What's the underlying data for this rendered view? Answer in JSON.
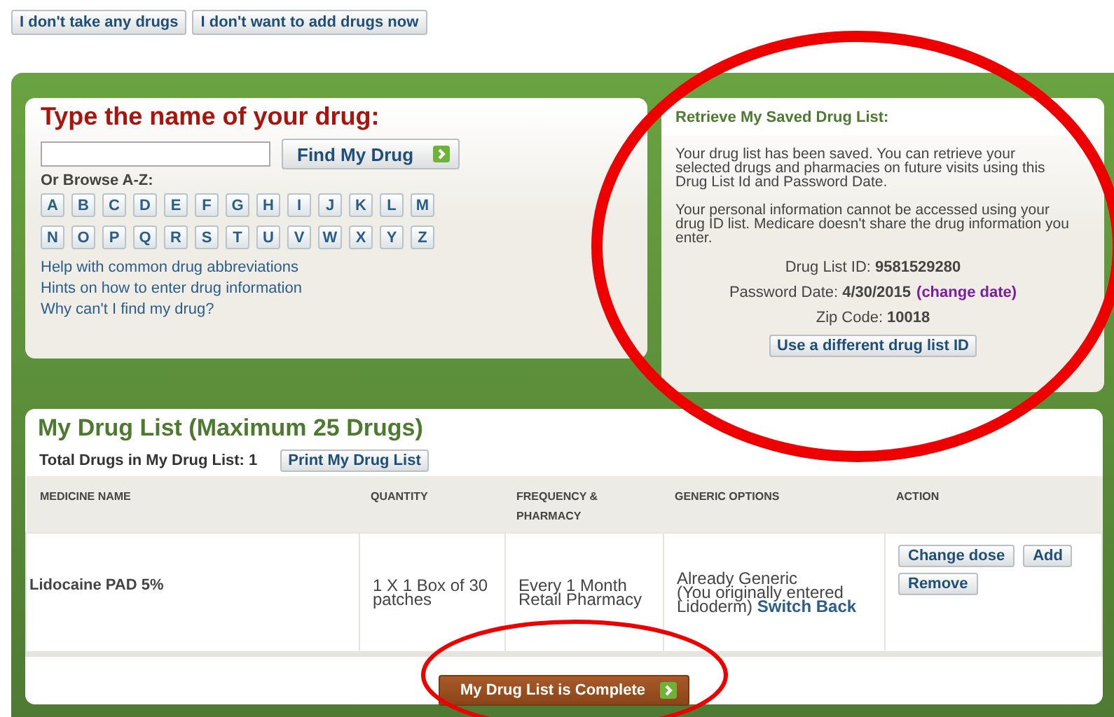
{
  "top_buttons": [
    "I don't take any drugs",
    "I don't want to add drugs now"
  ],
  "search": {
    "title": "Type the name of your drug:",
    "button": "Find My Drug",
    "browse_label": "Or Browse A-Z:",
    "letters": [
      "A",
      "B",
      "C",
      "D",
      "E",
      "F",
      "G",
      "H",
      "I",
      "J",
      "K",
      "L",
      "M",
      "N",
      "O",
      "P",
      "Q",
      "R",
      "S",
      "T",
      "U",
      "V",
      "W",
      "X",
      "Y",
      "Z"
    ],
    "links": [
      "Help with common drug abbreviations",
      "Hints on how to enter drug information",
      "Why can't I find my drug?"
    ]
  },
  "saved_list": {
    "title": "Retrieve My Saved Drug List:",
    "paragraphs": [
      "Your drug list has been saved. You can retrieve your selected drugs and pharmacies on future visits using this Drug List Id and Password Date.",
      "Your personal information cannot be accessed using your drug ID list. Medicare doesn't share the drug information you enter."
    ],
    "fields": [
      {
        "label": "Drug List ID:",
        "value": "9581529280"
      },
      {
        "label": "Password Date:",
        "value": "4/30/2015",
        "link": "(change date)"
      },
      {
        "label": "Zip Code:",
        "value": "10018"
      }
    ],
    "button": "Use a different drug list ID"
  },
  "drug_list": {
    "title": "My Drug List (Maximum 25 Drugs)",
    "total": "Total Drugs in My Drug List: 1",
    "print_button": "Print My Drug List",
    "columns": [
      "MEDICINE NAME",
      "QUANTITY",
      "FREQUENCY & PHARMACY",
      "GENERIC OPTIONS",
      "ACTION"
    ],
    "rows": [
      {
        "medicine": "Lidocaine PAD 5%",
        "quantity": "1 X 1 Box of 30 patches",
        "frequency": [
          "Every 1 Month",
          "Retail Pharmacy"
        ],
        "generic": "Already Generic",
        "generic_note": "(You originally entered Lidoderm)",
        "generic_link": "Switch Back",
        "actions": [
          "Change dose",
          "Add",
          "Remove"
        ]
      }
    ],
    "complete_button": "My Drug List is Complete"
  },
  "annotations": [
    {
      "kind": "ellipse"
    },
    {
      "kind": "ellipse"
    }
  ]
}
